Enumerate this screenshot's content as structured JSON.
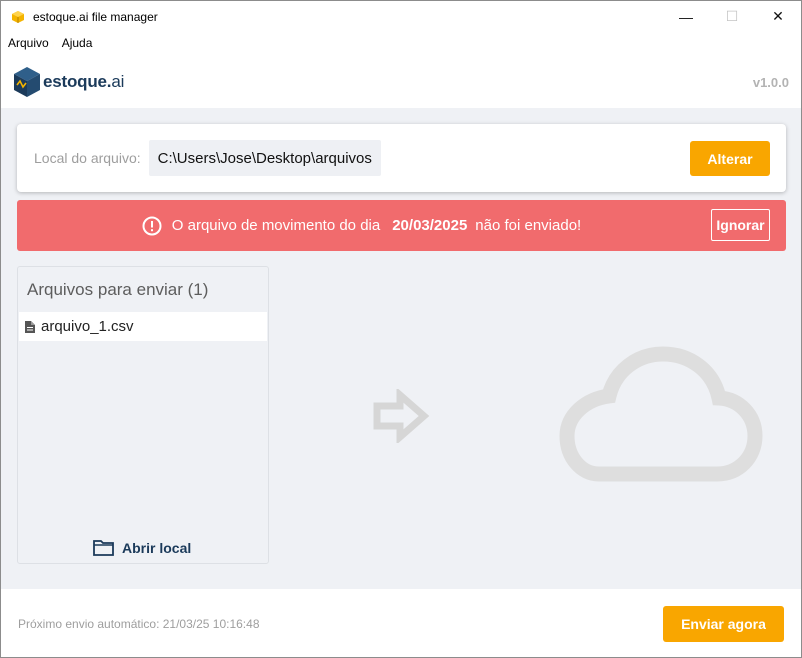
{
  "window": {
    "title": "estoque.ai file manager",
    "minimize_glyph": "—",
    "maximize_glyph": "☐",
    "close_glyph": "✕"
  },
  "menu": {
    "items": [
      {
        "label": "Arquivo"
      },
      {
        "label": "Ajuda"
      }
    ]
  },
  "header": {
    "logo_main": "estoque",
    "logo_dot": ".",
    "logo_suffix": "ai",
    "version": "v1.0.0"
  },
  "path_card": {
    "label": "Local do arquivo:",
    "value": "C:\\Users\\Jose\\Desktop\\arquivos",
    "change_button": "Alterar"
  },
  "alert": {
    "text_before": "O arquivo de movimento do dia",
    "date": "20/03/2025",
    "text_after": "não foi enviado!",
    "ignore_button": "Ignorar",
    "icon": "exclamation-circle-icon",
    "color": "#f16b6d"
  },
  "files_panel": {
    "title": "Arquivos para enviar (1)",
    "files": [
      {
        "name": "arquivo_1.csv",
        "icon": "file-icon"
      }
    ],
    "open_local_label": "Abrir local"
  },
  "illustration": {
    "arrow_icon": "arrow-right-icon",
    "cloud_icon": "cloud-icon"
  },
  "footer": {
    "next_send": "Próximo envio automático: 21/03/25 10:16:48",
    "send_now_button": "Enviar agora"
  },
  "colors": {
    "accent": "#f9a600",
    "brand": "#1b3a5a",
    "background": "#eff1f5"
  }
}
